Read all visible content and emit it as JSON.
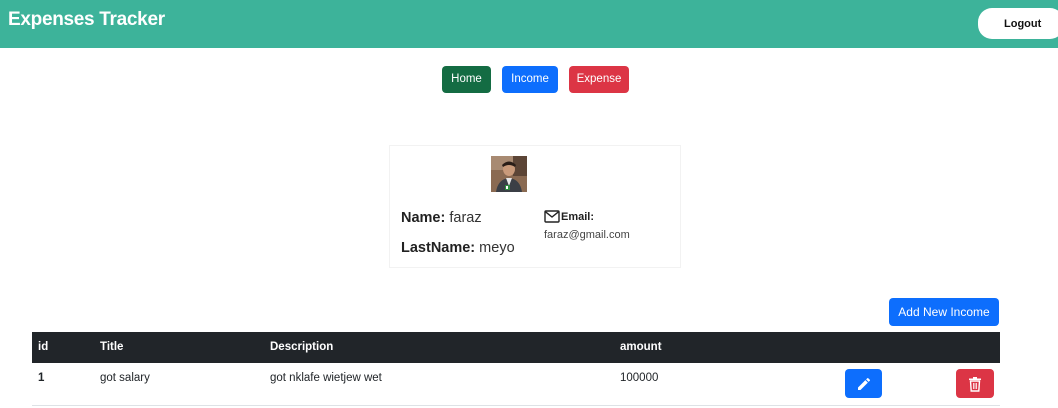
{
  "app": {
    "title": "Expenses Tracker",
    "logout_label": "Logout"
  },
  "nav": {
    "home_label": "Home",
    "income_label": "Income",
    "expense_label": "Expense"
  },
  "profile": {
    "name_label": "Name:",
    "name_value": "faraz",
    "lastname_label": "LastName:",
    "lastname_value": "meyo",
    "email_label": "Email:",
    "email_value": "faraz@gmail.com"
  },
  "income": {
    "add_button_label": "Add New Income",
    "columns": [
      "id",
      "Title",
      "Description",
      "amount"
    ],
    "rows": [
      {
        "id": "1",
        "title": "got salary",
        "description": "got nklafe wietjew wet",
        "amount": "100000"
      }
    ]
  },
  "icons": {
    "email": "mail-icon",
    "edit": "pencil-icon",
    "delete": "trash-icon"
  },
  "colors": {
    "header": "#3db39a",
    "home": "#146c43",
    "primary": "#0d6efd",
    "danger": "#dc3545",
    "table_head": "#212529"
  }
}
